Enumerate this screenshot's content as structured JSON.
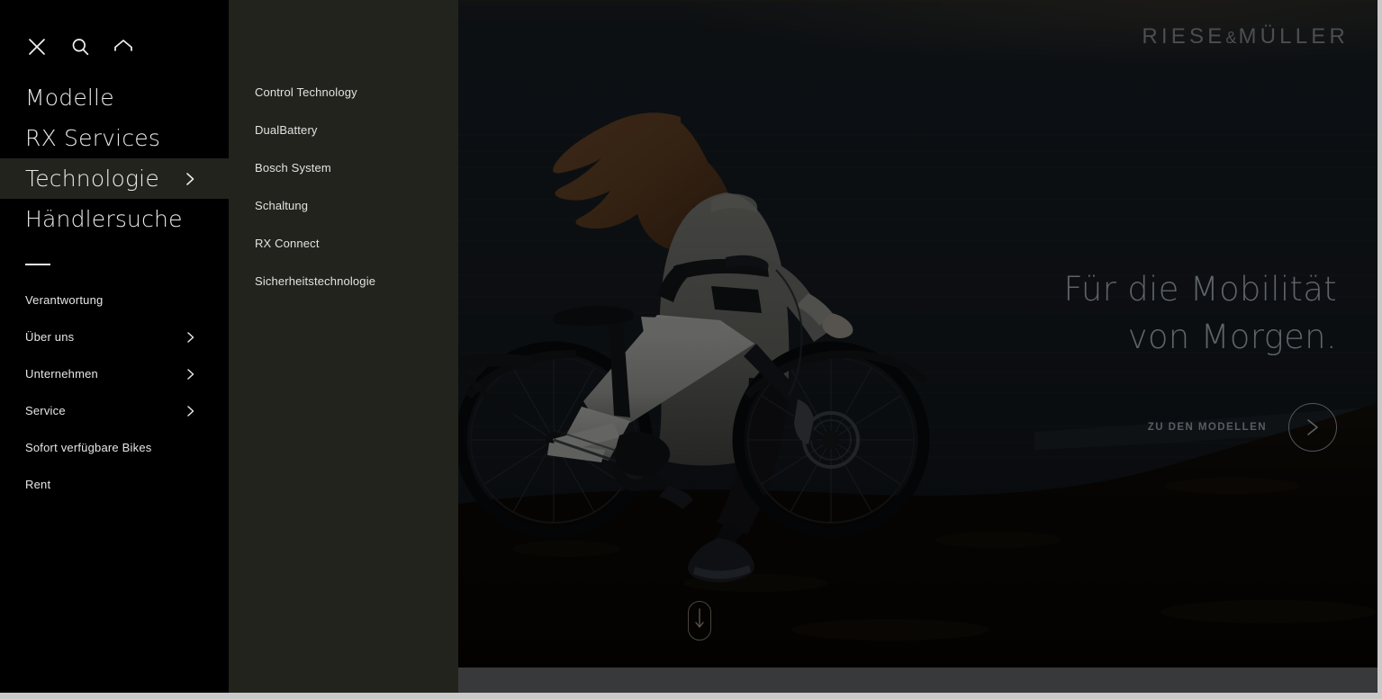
{
  "sidebar": {
    "icons": [
      {
        "name": "close-icon",
        "label": "Schließen"
      },
      {
        "name": "search-icon",
        "label": "Suche"
      },
      {
        "name": "home-icon",
        "label": "Startseite"
      }
    ],
    "main_nav": [
      {
        "label": "Modelle",
        "has_chevron": false,
        "active": false
      },
      {
        "label": "RX Services",
        "has_chevron": false,
        "active": false
      },
      {
        "label": "Technologie",
        "has_chevron": true,
        "active": true
      },
      {
        "label": "Händlersuche",
        "has_chevron": false,
        "active": false
      }
    ],
    "sub_nav": [
      {
        "label": "Verantwortung",
        "has_chevron": false
      },
      {
        "label": "Über uns",
        "has_chevron": true
      },
      {
        "label": "Unternehmen",
        "has_chevron": true
      },
      {
        "label": "Service",
        "has_chevron": true
      },
      {
        "label": "Sofort verfügbare Bikes",
        "has_chevron": false
      },
      {
        "label": "Rent",
        "has_chevron": false
      }
    ]
  },
  "submenu": {
    "parent": "Technologie",
    "items": [
      {
        "label": "Control Technology"
      },
      {
        "label": "DualBattery"
      },
      {
        "label": "Bosch System"
      },
      {
        "label": "Schaltung"
      },
      {
        "label": "RX Connect"
      },
      {
        "label": "Sicherheitstechnologie"
      }
    ]
  },
  "hero": {
    "logo_main": "RIESE",
    "logo_amp": "&",
    "logo_second": "MÜLLER",
    "headline_line1": "Für die Mobilität",
    "headline_line2": "von Morgen.",
    "cta_label": "ZU DEN MODELLEN",
    "cta_icon": "chevron-right-icon",
    "scroll_icon": "scroll-down-icon",
    "image_description": "Frau mit wehendem Haar schiebt ein weißes E-Bike am Seeufer in der Dämmerung"
  },
  "colors": {
    "sidebar_bg": "#000000",
    "submenu_bg": "#22231d",
    "hero_water": "#1a2026",
    "hero_ground": "#0d0906",
    "text_primary": "#e9e9e9",
    "hero_text": "#5e6468",
    "logo": "#4a4f52",
    "window_border": "#c9c9c9"
  }
}
